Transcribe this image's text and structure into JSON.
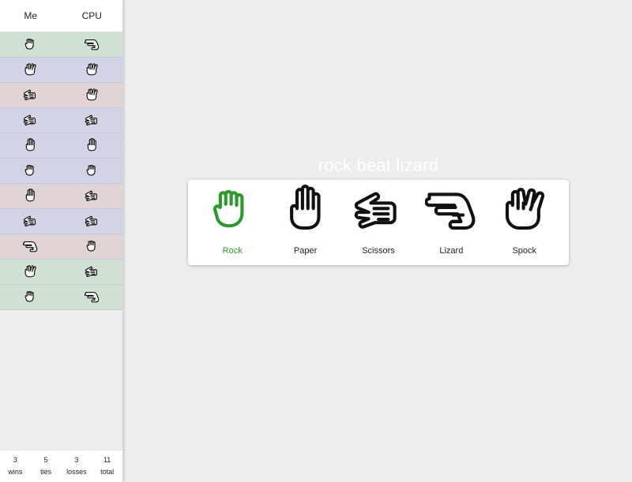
{
  "history": {
    "header": {
      "me": "Me",
      "cpu": "CPU"
    },
    "rows": [
      {
        "me": "rock-icon",
        "cpu": "lizard-icon",
        "result": "win"
      },
      {
        "me": "spock-icon",
        "cpu": "spock-icon",
        "result": "tie"
      },
      {
        "me": "scissors-icon",
        "cpu": "spock-icon",
        "result": "loss"
      },
      {
        "me": "scissors-icon",
        "cpu": "scissors-icon",
        "result": "tie"
      },
      {
        "me": "paper-icon",
        "cpu": "paper-icon",
        "result": "tie"
      },
      {
        "me": "rock-icon",
        "cpu": "rock-icon",
        "result": "tie"
      },
      {
        "me": "paper-icon",
        "cpu": "scissors-icon",
        "result": "loss"
      },
      {
        "me": "scissors-icon",
        "cpu": "scissors-icon",
        "result": "tie"
      },
      {
        "me": "lizard-icon",
        "cpu": "rock-icon",
        "result": "loss"
      },
      {
        "me": "spock-icon",
        "cpu": "scissors-icon",
        "result": "win"
      },
      {
        "me": "rock-icon",
        "cpu": "lizard-icon",
        "result": "win"
      }
    ]
  },
  "stats": {
    "wins": {
      "value": "3",
      "label": "wins"
    },
    "ties": {
      "value": "5",
      "label": "ties"
    },
    "losses": {
      "value": "3",
      "label": "losses"
    },
    "total": {
      "value": "11",
      "label": "total"
    }
  },
  "result_text": "rock beat lizard",
  "choices": [
    {
      "label": "Rock",
      "icon": "rock-icon",
      "selected": true
    },
    {
      "label": "Paper",
      "icon": "paper-icon",
      "selected": false
    },
    {
      "label": "Scissors",
      "icon": "scissors-icon",
      "selected": false
    },
    {
      "label": "Lizard",
      "icon": "lizard-icon",
      "selected": false
    },
    {
      "label": "Spock",
      "icon": "spock-icon",
      "selected": false
    }
  ],
  "colors": {
    "win_row": "#cfe2d1",
    "tie_row": "#d3d3e7",
    "loss_row": "#e2d4d4",
    "selected": "#2a9a2a",
    "icon": "#111111"
  }
}
